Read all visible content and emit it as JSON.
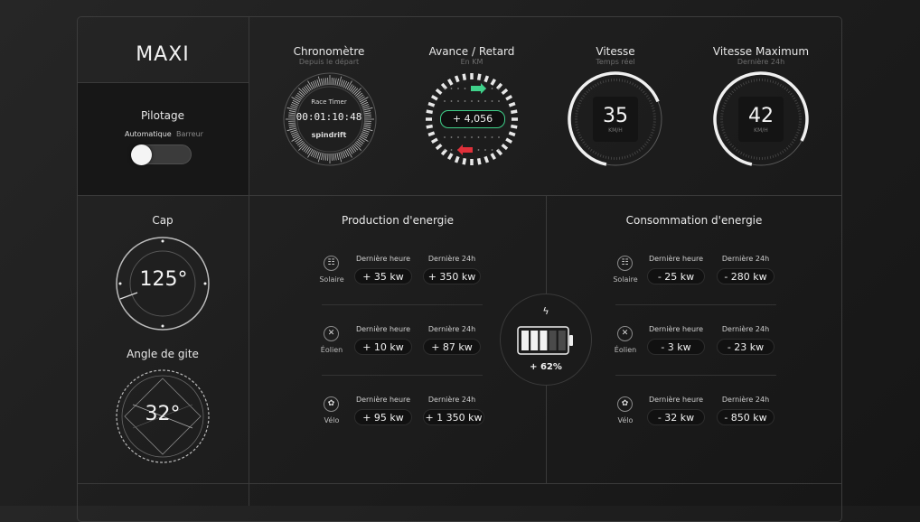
{
  "brand": {
    "title": "MAXI"
  },
  "pilotage": {
    "title": "Pilotage",
    "option_auto": "Automatique",
    "option_barreur": "Barreur"
  },
  "chrono": {
    "title": "Chronomètre",
    "subtitle": "Depuis le départ",
    "label_top": "Race Timer",
    "time": "00:01:10:48",
    "label_bottom": "spindrift"
  },
  "avance": {
    "title": "Avance / Retard",
    "subtitle": "En KM",
    "value": "+ 4,056"
  },
  "vitesse": {
    "title": "Vitesse",
    "subtitle": "Temps réel",
    "value": "35",
    "unit": "KM/H",
    "level": 0.7
  },
  "vitesse_max": {
    "title": "Vitesse Maximum",
    "subtitle": "Dernière 24h",
    "value": "42",
    "unit": "KM/H",
    "level": 0.85
  },
  "cap": {
    "title": "Cap",
    "value": "125°"
  },
  "gite": {
    "title": "Angle de gite",
    "value": "32°"
  },
  "production": {
    "title": "Production d'energie",
    "col_hour": "Dernière heure",
    "col_day": "Dernière 24h",
    "rows": [
      {
        "name": "Solaire",
        "icon": "solar-icon",
        "hour": "+ 35 kw",
        "day": "+ 350 kw"
      },
      {
        "name": "Éolien",
        "icon": "wind-icon",
        "hour": "+ 10 kw",
        "day": "+ 87 kw"
      },
      {
        "name": "Vélo",
        "icon": "bike-icon",
        "hour": "+ 95 kw",
        "day": "+ 1 350 kw"
      }
    ]
  },
  "battery": {
    "icon": "bolt-icon",
    "value": "+ 62%",
    "level": 0.62
  },
  "consommation": {
    "title": "Consommation d'energie",
    "col_hour": "Dernière heure",
    "col_day": "Dernière 24h",
    "rows": [
      {
        "name": "Solaire",
        "icon": "solar-icon",
        "hour": "- 25 kw",
        "day": "- 280 kw"
      },
      {
        "name": "Éolien",
        "icon": "wind-icon",
        "hour": "- 3 kw",
        "day": "- 23 kw"
      },
      {
        "name": "Vélo",
        "icon": "bike-icon",
        "hour": "- 32 kw",
        "day": "- 850 kw"
      }
    ]
  },
  "colors": {
    "green": "#3fd18a",
    "red": "#e0303a"
  }
}
